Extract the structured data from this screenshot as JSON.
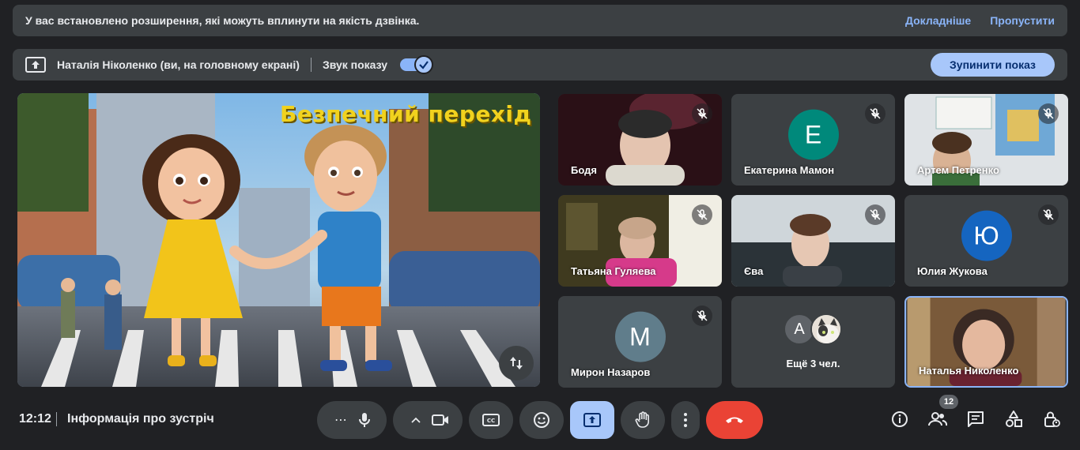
{
  "banner": {
    "message": "У вас встановлено розширення, які можуть вплинути на якість дзвінка.",
    "details_link": "Докладніше",
    "skip_link": "Пропустити"
  },
  "sharebar": {
    "presenter": "Наталія Ніколенко (ви, на головному екрані)",
    "sound_label": "Звук показу",
    "sound_on": true,
    "stop_button": "Зупинити показ"
  },
  "presentation": {
    "slide_title": "Безпечний перехід"
  },
  "participants": [
    {
      "name": "Бодя",
      "type": "video",
      "muted": true
    },
    {
      "name": "Екатерина Мамон",
      "type": "avatar",
      "initial": "Е",
      "color": "#00897b",
      "muted": true
    },
    {
      "name": "Артем Петренко",
      "type": "video",
      "muted": true
    },
    {
      "name": "Татьяна Гуляева",
      "type": "video",
      "muted": true
    },
    {
      "name": "Єва",
      "type": "video",
      "muted": true
    },
    {
      "name": "Юлия Жукова",
      "type": "avatar",
      "initial": "Ю",
      "color": "#1565c0",
      "muted": true
    },
    {
      "name": "Мирон Назаров",
      "type": "avatar",
      "initial": "М",
      "color": "#607d8b",
      "muted": true
    },
    {
      "name": "Наталья Николенко",
      "type": "video",
      "muted": false,
      "active": true
    }
  ],
  "more_tile": {
    "initial": "А",
    "label": "Ещё 3 чел."
  },
  "bottom": {
    "time": "12:12",
    "meeting_info": "Інформація про зустріч",
    "people_count": "12"
  },
  "colors": {
    "background": "#202124",
    "surface": "#3c4043",
    "accent": "#a8c7fa",
    "link": "#8ab4f8",
    "end_call": "#ea4335"
  }
}
